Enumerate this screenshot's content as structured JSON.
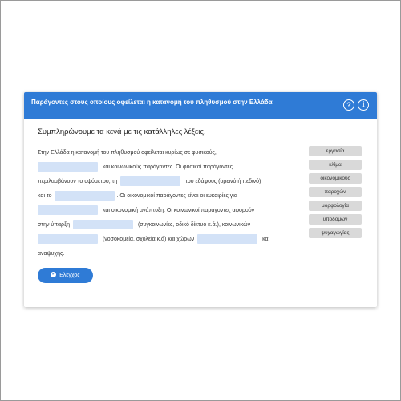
{
  "header": {
    "title": "Παράγοντες στους οποίους οφείλεται η κατανομή του πληθυσμού στην Ελλάδα",
    "help_icon": "help-icon",
    "info_icon": "info-icon",
    "help_glyph": "?",
    "info_glyph": "i"
  },
  "instruction": "Συμπληρώνουμε τα κενά με τις κατάλληλες λέξεις.",
  "passage": {
    "line1": "Στην Ελλάδα η κατανομή του πληθυσμού οφείλεται κυρίως σε φυσικούς,",
    "line2": "και κοινωνικούς παράγοντες. Οι φυσικοί παράγοντες",
    "line3a": "περιλαμβάνουν το υψόμετρο, τη",
    "line3b": "του εδάφους (ορεινό ή πεδινό)",
    "line4a": "και το",
    "line4b": ". Οι οικονομικοί παράγοντες είναι οι ευκαιρίες για",
    "line5": "και οικονομική ανάπτυξη. Οι κοινωνικοί παράγοντες αφορούν",
    "line6a": "στην ύπαρξη",
    "line6b": "(συγκοινωνίες, οδικό δίκτυο κ.ά.), κοινωνικών",
    "line7a": "(νοσοκομεία, σχολεία κ.ά) και χώρων",
    "line7b": "και",
    "line8": "αναψυχής."
  },
  "word_bank": [
    "εργασία",
    "κλίμα",
    "οικονομικούς",
    "παροχών",
    "μορφολογία",
    "υποδομών",
    "ψυχαγωγίας"
  ],
  "check_button": {
    "label": "Έλεγχος",
    "icon": "check-circle-icon",
    "glyph": "✔"
  },
  "colors": {
    "accent": "#2f7bd6",
    "blank": "#d3e2f7",
    "chip": "#d9d9d9"
  }
}
